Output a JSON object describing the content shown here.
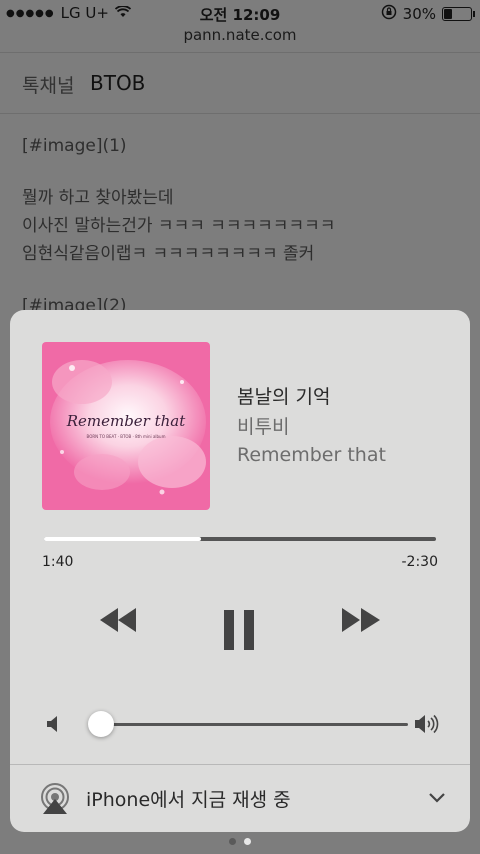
{
  "status_bar": {
    "carrier": "LG U+",
    "time": "오전 12:09",
    "battery": "30%",
    "battery_level": 0.3
  },
  "browser": {
    "url": "pann.nate.com"
  },
  "page": {
    "channel_label": "톡채널",
    "channel_name": "BTOB",
    "image_ref_1": "[#image](1)",
    "lines": [
      "뭘까 하고 찾아봤는데",
      "이사진 말하는건가 ㅋㅋㅋ ㅋㅋㅋㅋㅋㅋㅋㅋ",
      "임현식같음이랩ㅋ ㅋㅋㅋㅋㅋㅋㅋㅋ 졸커"
    ],
    "image_ref_2": "[#image](2)",
    "page_dots": 2,
    "active_dot": 1
  },
  "now_playing": {
    "title": "봄날의 기억",
    "artist": "비투비",
    "album": "Remember that",
    "artwork_text": "Remember that",
    "artwork_subtext": "BORN TO BEAT · BTOB · 8th mini album",
    "elapsed": "1:40",
    "remaining": "-2:30",
    "progress": 0.4,
    "volume": 0.04,
    "airplay_label": "iPhone에서 지금 재생 중",
    "accent": "#f06aa6"
  }
}
